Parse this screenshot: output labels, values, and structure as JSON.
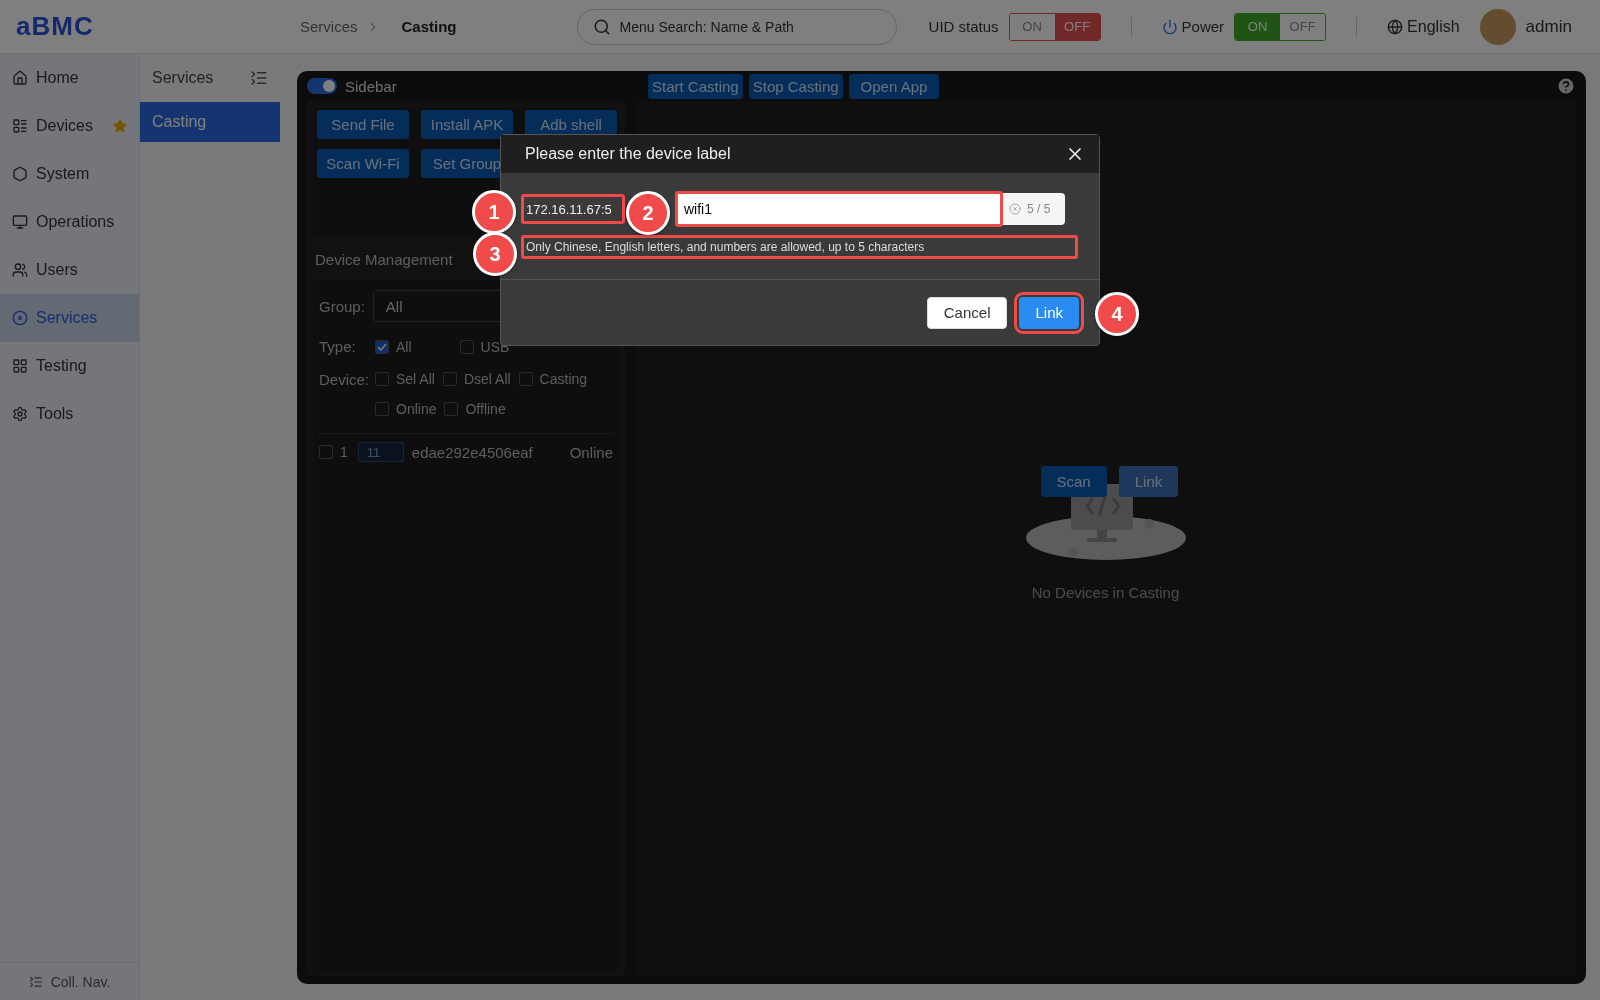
{
  "header": {
    "logo": "aBMC",
    "breadcrumb": [
      "Services",
      "Casting"
    ],
    "search_placeholder": "Menu Search: Name & Path",
    "uid_status": {
      "label": "UID status",
      "options": [
        {
          "label": "ON",
          "selected": false
        },
        {
          "label": "OFF",
          "selected": true
        }
      ]
    },
    "power": {
      "label": "Power",
      "options": [
        {
          "label": "ON",
          "selected": true
        },
        {
          "label": "OFF",
          "selected": false
        }
      ]
    },
    "language": "English",
    "user": "admin"
  },
  "nav": {
    "items": [
      {
        "label": "Home",
        "selected": false,
        "starred": false
      },
      {
        "label": "Devices",
        "selected": false,
        "starred": true
      },
      {
        "label": "System",
        "selected": false,
        "starred": false
      },
      {
        "label": "Operations",
        "selected": false,
        "starred": false
      },
      {
        "label": "Users",
        "selected": false,
        "starred": false
      },
      {
        "label": "Services",
        "selected": true,
        "starred": false
      },
      {
        "label": "Testing",
        "selected": false,
        "starred": false
      },
      {
        "label": "Tools",
        "selected": false,
        "starred": false
      }
    ],
    "collapse": "Coll. Nav."
  },
  "subnav": {
    "title": "Services",
    "items": [
      {
        "label": "Casting",
        "selected": true
      }
    ]
  },
  "toolbar": {
    "sidebar_toggle": {
      "label": "Sidebar",
      "on": true
    },
    "buttons": [
      "Start Casting",
      "Stop Casting",
      "Open App"
    ]
  },
  "actions": [
    "Send File",
    "Install APK",
    "Adb shell",
    "Scan Wi-Fi",
    "Set Group"
  ],
  "device_management": {
    "title": "Device Management",
    "group_label": "Group:",
    "group_value": "All",
    "type_label": "Type:",
    "types": [
      {
        "label": "All",
        "checked": true
      },
      {
        "label": "USB",
        "checked": false
      }
    ],
    "device_label": "Device:",
    "filters": [
      {
        "label": "Sel All",
        "checked": false
      },
      {
        "label": "Dsel All",
        "checked": false
      },
      {
        "label": "Casting",
        "checked": false
      },
      {
        "label": "Online",
        "checked": false
      },
      {
        "label": "Offline",
        "checked": false
      }
    ],
    "devices": [
      {
        "index": "1",
        "tag": "11",
        "id": "edae292e4506eaf",
        "status": "Online",
        "checked": false
      }
    ]
  },
  "casting_area": {
    "buttons": [
      {
        "label": "Scan",
        "kind": "primary"
      },
      {
        "label": "Link",
        "kind": "secondary"
      }
    ],
    "empty_text": "No Devices in Casting"
  },
  "dialog": {
    "title": "Please enter the device label",
    "address": "172.16.11.67:5",
    "label_value": "wifi1",
    "count": "5 / 5",
    "hint": "Only Chinese, English letters, and numbers are allowed, up to 5 characters",
    "buttons": [
      {
        "label": "Cancel",
        "kind": "default"
      },
      {
        "label": "Link",
        "kind": "primary"
      }
    ]
  },
  "callouts": [
    "1",
    "2",
    "3",
    "4"
  ]
}
